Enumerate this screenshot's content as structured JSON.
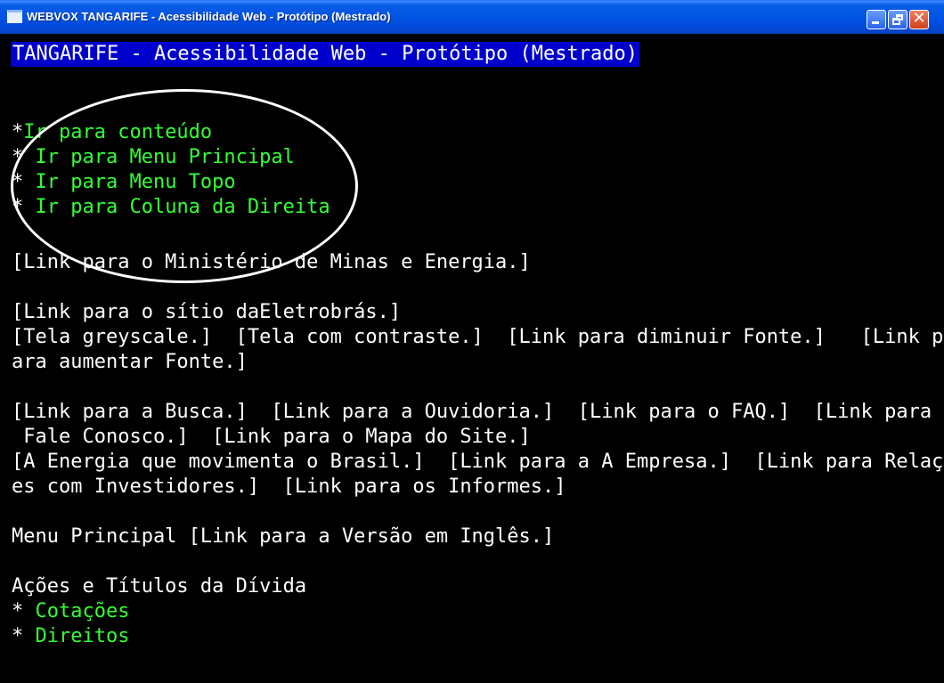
{
  "window": {
    "title": "WEBVOX TANGARIFE - Acessibilidade Web - Protótipo (Mestrado)",
    "controls": {
      "minimize": "minimize",
      "maximize": "restore",
      "close": "✕"
    }
  },
  "screen": {
    "header": "TANGARIFE - Acessibilidade Web - Protótipo (Mestrado)",
    "skip_links": [
      {
        "bullet": "*",
        "label": "Ir para conteúdo"
      },
      {
        "bullet": "*",
        "label": "Ir para Menu Principal"
      },
      {
        "bullet": "*",
        "label": "Ir para Menu Topo"
      },
      {
        "bullet": "*",
        "label": "Ir para Coluna da Direita"
      }
    ],
    "lines": [
      "[Link para o Ministério de Minas e Energia.]",
      "[Link para o sítio daEletrobrás.]",
      "[Tela greyscale.]  [Tela com contraste.]  [Link para diminuir Fonte.]   [Link p",
      "ara aumentar Fonte.]",
      "[Link para a Busca.]  [Link para a Ouvidoria.]  [Link para o FAQ.]  [Link para o",
      " Fale Conosco.]  [Link para o Mapa do Site.]",
      "[A Energia que movimenta o Brasil.]  [Link para a A Empresa.]  [Link para Relaçõ",
      "es com Investidores.]  [Link para os Informes.]",
      "Menu Principal [Link para a Versão em Inglês.]",
      "Ações e Títulos da Dívida"
    ],
    "submenu": [
      {
        "bullet": "*",
        "label": " Cotações"
      },
      {
        "bullet": "*",
        "label": " Direitos"
      }
    ]
  },
  "colors": {
    "link_green": "#33ff33",
    "text_white": "#ffffff",
    "header_bg": "#0000cc",
    "titlebar_blue": "#0054e3"
  }
}
